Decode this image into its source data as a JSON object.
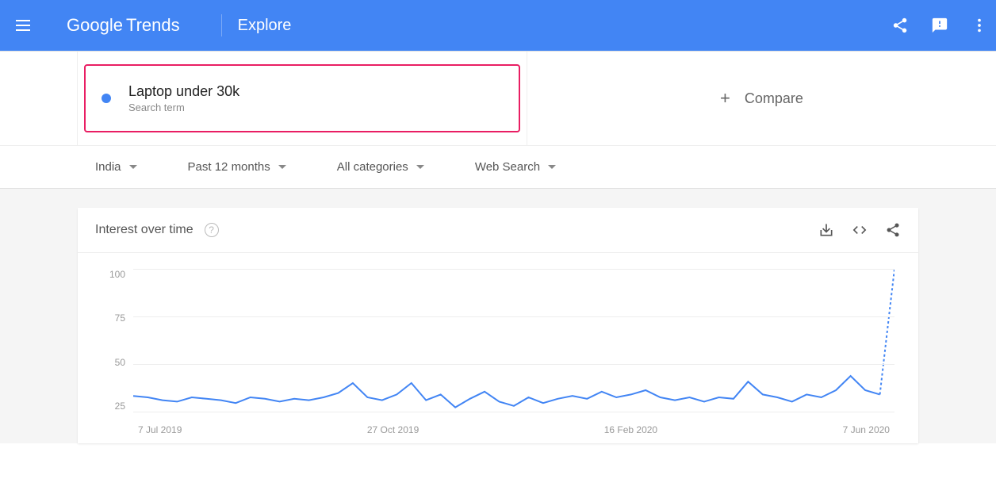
{
  "header": {
    "logo_g": "Google",
    "logo_t": "Trends",
    "explore": "Explore"
  },
  "search_term": {
    "label": "Laptop under 30k",
    "sub": "Search term"
  },
  "compare": {
    "label": "Compare"
  },
  "filters": {
    "region": "India",
    "time": "Past 12 months",
    "category": "All categories",
    "search_type": "Web Search"
  },
  "chart": {
    "title": "Interest over time",
    "y_labels": [
      "100",
      "75",
      "50",
      "25"
    ],
    "x_labels": [
      "7 Jul 2019",
      "27 Oct 2019",
      "16 Feb 2020",
      "7 Jun 2020"
    ]
  },
  "chart_data": {
    "type": "line",
    "title": "Interest over time",
    "ylabel": "",
    "xlabel": "",
    "ylim": [
      0,
      100
    ],
    "series": [
      {
        "name": "Laptop under 30k",
        "color": "#4285f4",
        "x": [
          "7 Jul 2019",
          "14 Jul",
          "21 Jul",
          "28 Jul",
          "4 Aug",
          "11 Aug",
          "18 Aug",
          "25 Aug",
          "1 Sep",
          "8 Sep",
          "15 Sep",
          "22 Sep",
          "29 Sep",
          "6 Oct",
          "13 Oct",
          "20 Oct",
          "27 Oct",
          "3 Nov",
          "10 Nov",
          "17 Nov",
          "24 Nov",
          "1 Dec",
          "8 Dec",
          "15 Dec",
          "22 Dec",
          "29 Dec",
          "5 Jan 2020",
          "12 Jan",
          "19 Jan",
          "26 Jan",
          "2 Feb",
          "9 Feb",
          "16 Feb",
          "23 Feb",
          "1 Mar",
          "8 Mar",
          "15 Mar",
          "22 Mar",
          "29 Mar",
          "5 Apr",
          "12 Apr",
          "19 Apr",
          "26 Apr",
          "3 May",
          "10 May",
          "17 May",
          "24 May",
          "31 May",
          "7 Jun",
          "14 Jun",
          "21 Jun",
          "28 Jun",
          "5 Jul"
        ],
        "values": [
          11,
          10,
          8,
          7,
          10,
          9,
          8,
          6,
          10,
          9,
          7,
          9,
          8,
          10,
          13,
          20,
          10,
          8,
          12,
          20,
          8,
          12,
          3,
          9,
          14,
          7,
          4,
          10,
          6,
          9,
          11,
          9,
          14,
          10,
          12,
          15,
          10,
          8,
          10,
          7,
          10,
          9,
          21,
          12,
          10,
          7,
          12,
          10,
          15,
          25,
          15,
          12,
          100
        ]
      }
    ]
  }
}
